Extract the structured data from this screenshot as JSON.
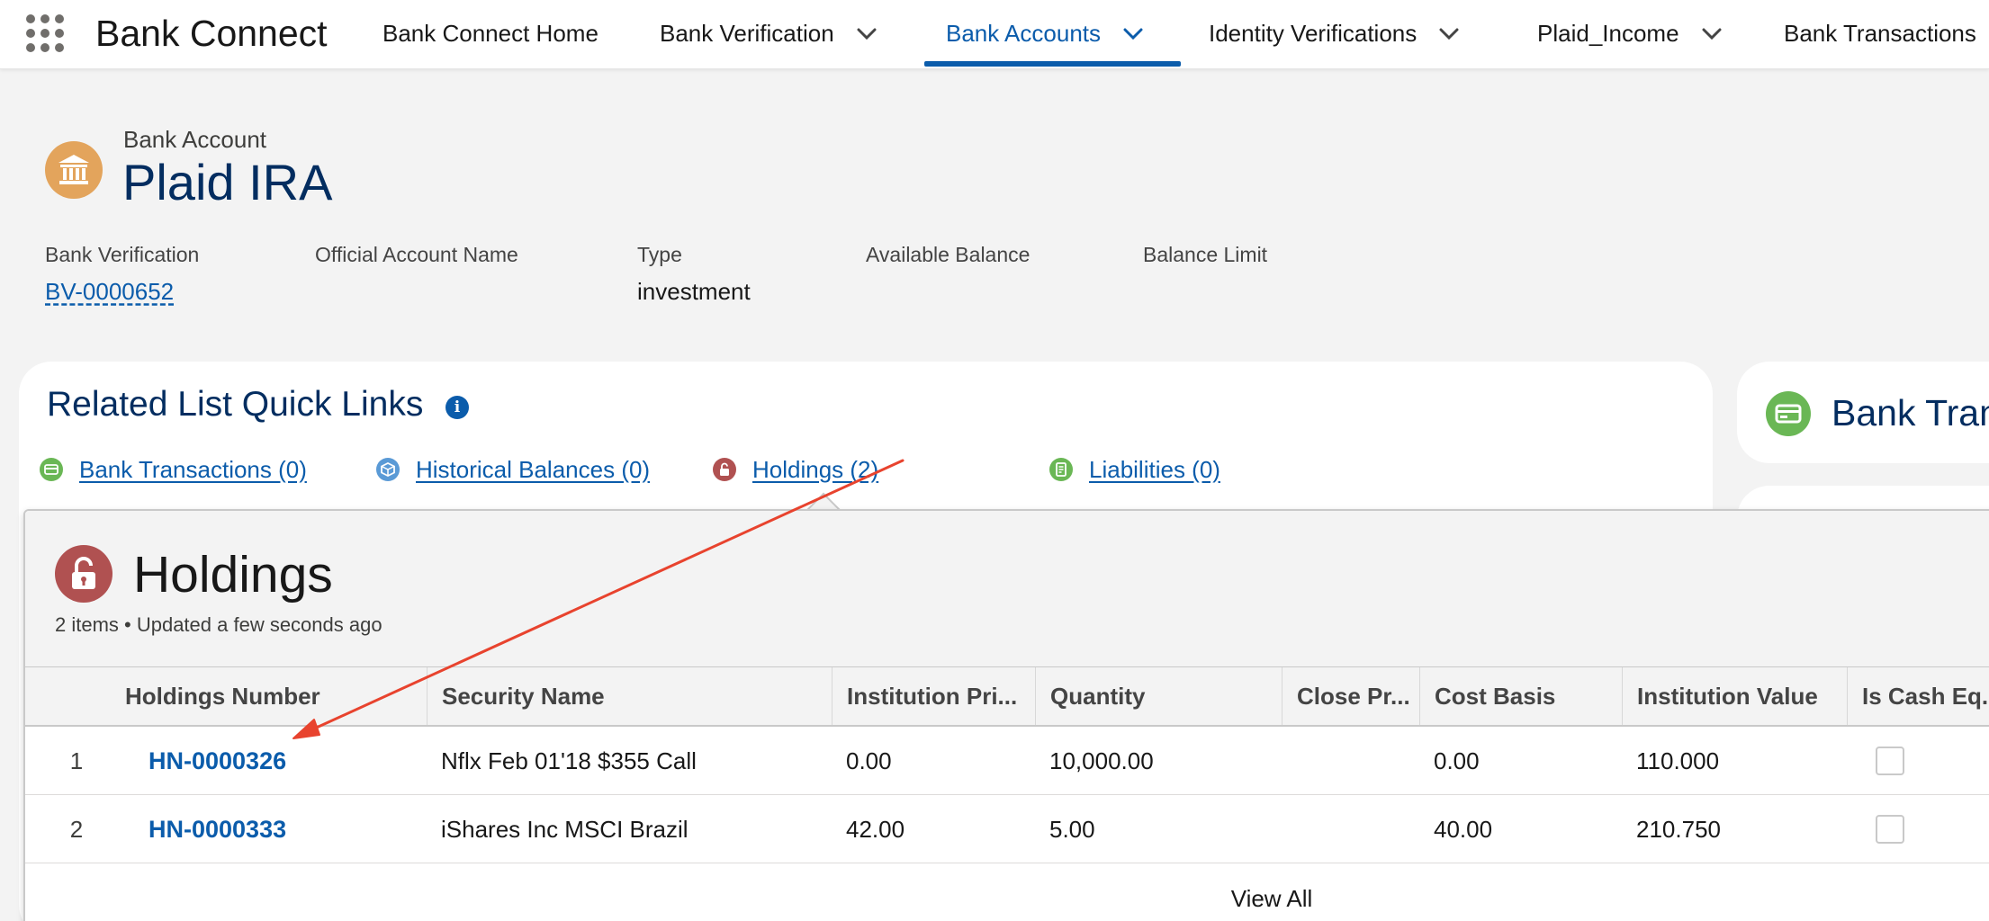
{
  "app": {
    "name": "Bank Connect"
  },
  "nav": {
    "items": [
      {
        "label": "Bank Connect Home",
        "has_menu": false,
        "active": false
      },
      {
        "label": "Bank Verification",
        "has_menu": true,
        "active": false
      },
      {
        "label": "Bank Accounts",
        "has_menu": true,
        "active": true
      },
      {
        "label": "Identity Verifications",
        "has_menu": true,
        "active": false
      },
      {
        "label": "Plaid_Income",
        "has_menu": true,
        "active": false
      },
      {
        "label": "Bank Transactions",
        "has_menu": false,
        "active": false
      }
    ]
  },
  "record": {
    "object_label": "Bank Account",
    "title": "Plaid IRA",
    "icon": "bank-icon",
    "fields": [
      {
        "label": "Bank Verification",
        "value": "BV-0000652",
        "is_link": true
      },
      {
        "label": "Official Account Name",
        "value": "",
        "is_link": false
      },
      {
        "label": "Type",
        "value": "investment",
        "is_link": false
      },
      {
        "label": "Available Balance",
        "value": "",
        "is_link": false
      },
      {
        "label": "Balance Limit",
        "value": "",
        "is_link": false
      }
    ]
  },
  "related_quick_links": {
    "title": "Related List Quick Links",
    "links": [
      {
        "label": "Bank Transactions (0)",
        "icon": "bank-transactions-icon"
      },
      {
        "label": "Historical Balances (0)",
        "icon": "historical-balances-icon"
      },
      {
        "label": "Holdings (2)",
        "icon": "holdings-lock-icon"
      },
      {
        "label": "Liabilities (0)",
        "icon": "liabilities-icon"
      }
    ]
  },
  "side_card": {
    "title": "Bank Tran",
    "icon": "bank-transactions-icon"
  },
  "holdings_popover": {
    "title": "Holdings",
    "subtitle": "2 items • Updated a few seconds ago",
    "columns": [
      "Holdings Number",
      "Security Name",
      "Institution Pri...",
      "Quantity",
      "Close Pr...",
      "Cost Basis",
      "Institution Value",
      "Is Cash Eq..."
    ],
    "rows": [
      {
        "row_num": "1",
        "holdings_number": "HN-0000326",
        "security_name": "Nflx Feb 01'18 $355 Call",
        "institution_price": "0.00",
        "quantity": "10,000.00",
        "close_price": "",
        "cost_basis": "0.00",
        "institution_value": "110.000",
        "is_cash_equivalent": false
      },
      {
        "row_num": "2",
        "holdings_number": "HN-0000333",
        "security_name": "iShares Inc MSCI Brazil",
        "institution_price": "42.00",
        "quantity": "5.00",
        "close_price": "",
        "cost_basis": "40.00",
        "institution_value": "210.750",
        "is_cash_equivalent": false
      }
    ],
    "view_all_label": "View All"
  },
  "colors": {
    "brand_blue": "#0b5cab",
    "title_navy": "#032d60",
    "bank_icon_bg": "#e3a45c",
    "holdings_icon_bg": "#b05151",
    "transactions_icon_bg": "#6ab755",
    "annotation_arrow": "#e8432e"
  }
}
